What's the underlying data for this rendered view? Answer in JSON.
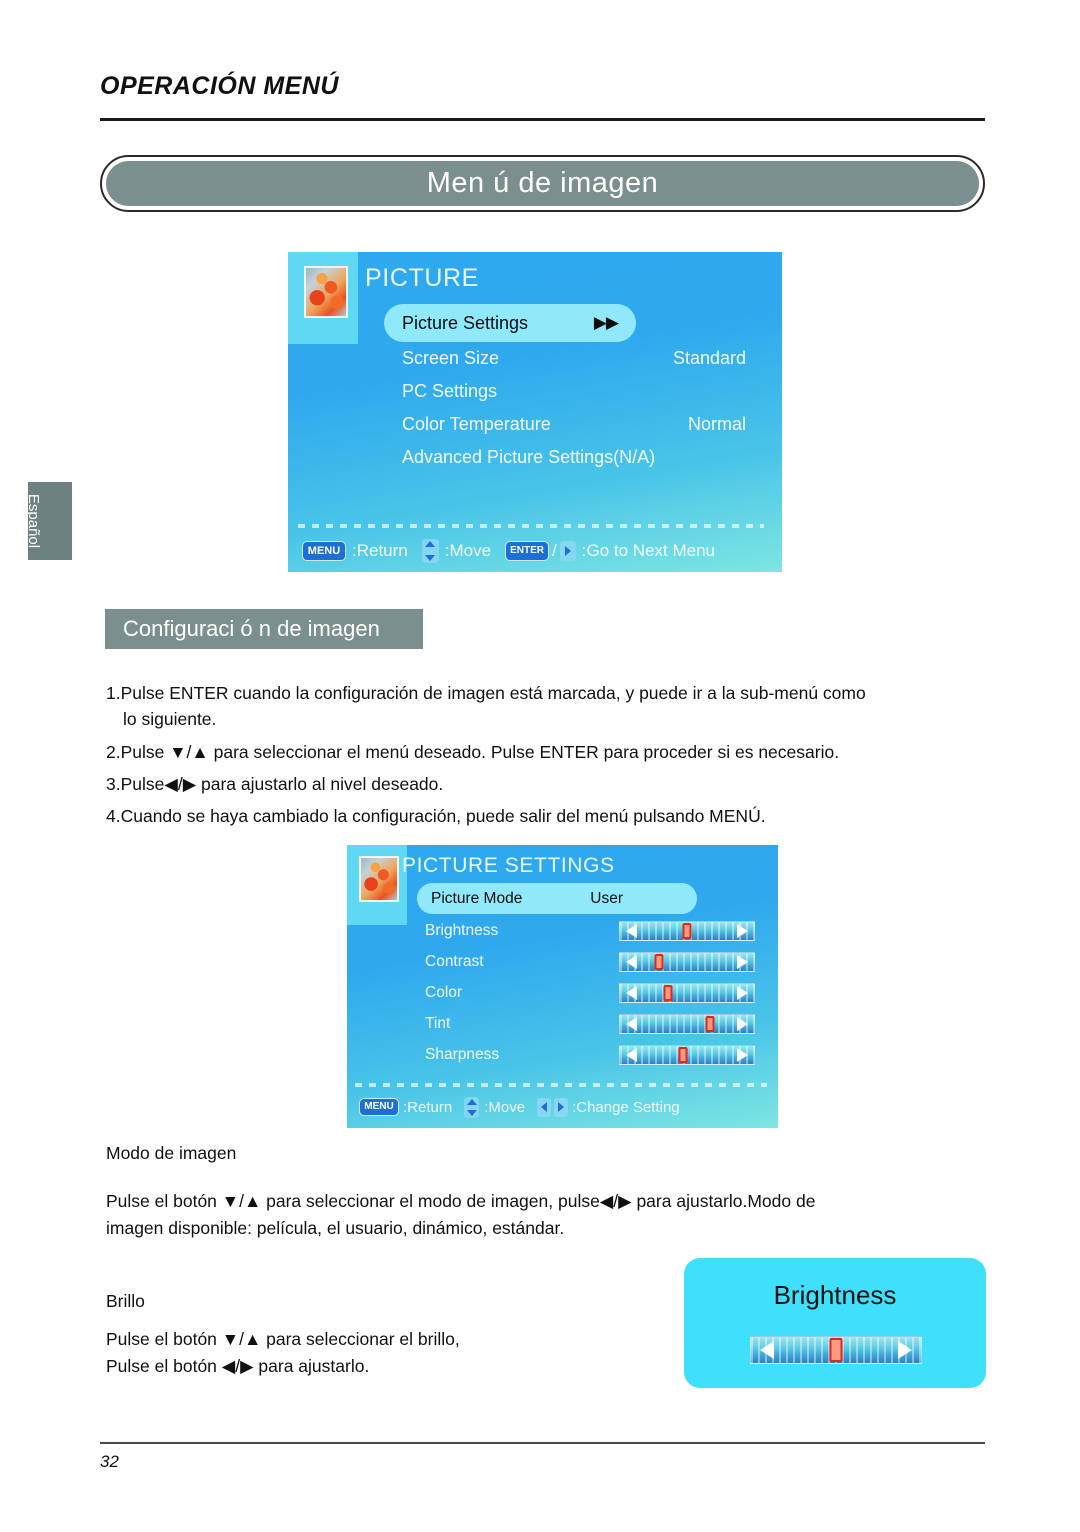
{
  "header": {
    "section_title": "OPERACIÓN MENÚ",
    "banner_title": "Men ú  de imagen"
  },
  "side_tab": {
    "label": "Español"
  },
  "osd_picture": {
    "title": "PICTURE",
    "thumbnail_icon": "picture-thumbnail-icon",
    "rows": [
      {
        "label": "Picture Settings",
        "value": "▶▶",
        "selected": true
      },
      {
        "label": "Screen Size",
        "value": "Standard",
        "selected": false
      },
      {
        "label": "PC Settings",
        "value": "",
        "selected": false
      },
      {
        "label": "Color Temperature",
        "value": "Normal",
        "selected": false
      },
      {
        "label": "Advanced Picture Settings(N/A)",
        "value": "",
        "selected": false
      }
    ],
    "statusbar": {
      "menu_key": "MENU",
      "return_label": ":Return",
      "move_label": ":Move",
      "enter_key": "ENTER",
      "separator": "/",
      "next_menu_label": ":Go to Next Menu"
    }
  },
  "subheading": {
    "label": "Configuraci ó n de imagen"
  },
  "instructions": [
    "1.Pulse ENTER cuando la configuración de imagen está marcada, y puede ir a la sub-menú como",
    "lo siguiente.",
    "2.Pulse ▼/▲  para seleccionar el menú deseado. Pulse ENTER para proceder si es necesario.",
    "3.Pulse◀/▶ para ajustarlo al nivel deseado.",
    "4.Cuando se haya cambiado la configuración, puede salir del menú pulsando MENÚ."
  ],
  "osd_picture_settings": {
    "title": "PICTURE SETTINGS",
    "thumbnail_icon": "picture-thumbnail-icon",
    "mode_row": {
      "label": "Picture Mode",
      "value": "User",
      "selected": true
    },
    "sliders": [
      {
        "label": "Brightness",
        "percent": 50
      },
      {
        "label": "Contrast",
        "percent": 29
      },
      {
        "label": "Color",
        "percent": 36
      },
      {
        "label": "Tint",
        "percent": 67
      },
      {
        "label": "Sharpness",
        "percent": 47
      }
    ],
    "statusbar": {
      "menu_key": "MENU",
      "return_label": ":Return",
      "move_label": ":Move",
      "change_label": ":Change Setting"
    }
  },
  "picture_mode_section": {
    "heading": "Modo de imagen",
    "line1": "Pulse el botón ▼/▲ para seleccionar el modo de imagen, pulse◀/▶ para ajustarlo.Modo de",
    "line2": "imagen disponible: película, el usuario, dinámico, estándar."
  },
  "brightness_section": {
    "heading": "Brillo",
    "line1": "Pulse el botón ▼/▲ para seleccionar el brillo,",
    "line2": "Pulse el botón ◀/▶ para ajustarlo."
  },
  "brightness_callout": {
    "title": "Brightness",
    "slider_percent": 50
  },
  "footer": {
    "page_number": "32"
  },
  "colors": {
    "banner_grey": "#7b8f8e",
    "osd_blue": "#2ea9ef",
    "osd_highlight": "#8fe9fb",
    "callout_cyan": "#3ee0fb",
    "knob_red": "#e2281c",
    "key_blue": "#1c6fd4"
  }
}
